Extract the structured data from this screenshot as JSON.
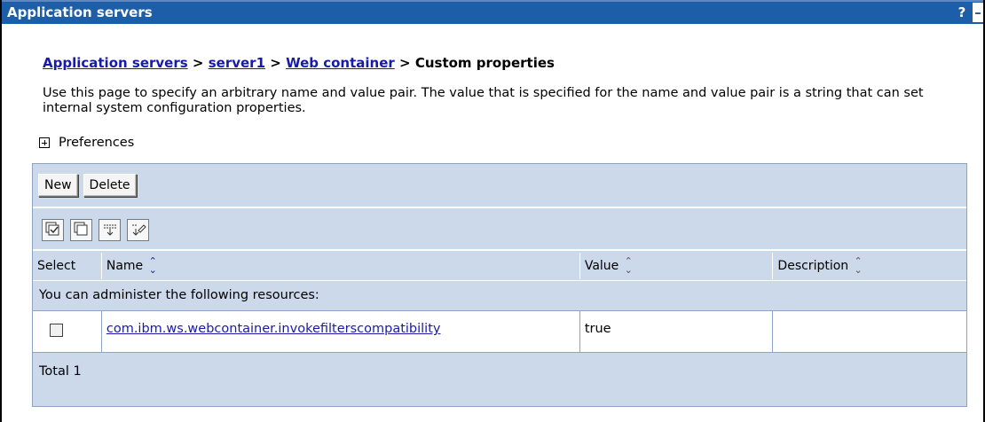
{
  "window": {
    "title": "Application servers",
    "help": "?",
    "minimize": "–"
  },
  "breadcrumb": {
    "items": [
      "Application servers",
      "server1",
      "Web container"
    ],
    "separator": ">",
    "current": "Custom properties"
  },
  "description": "Use this page to specify an arbitrary name and value pair. The value that is specified for the name and value pair is a string that can set internal system configuration properties.",
  "preferences": {
    "label": "Preferences"
  },
  "toolbar": {
    "new_label": "New",
    "delete_label": "Delete"
  },
  "icons": [
    "select-all-icon",
    "deselect-all-icon",
    "show-filter-icon",
    "clear-filter-icon"
  ],
  "table": {
    "headers": [
      "Select",
      "Name",
      "Value",
      "Description"
    ],
    "info": "You can administer the following resources:",
    "rows": [
      {
        "name": "com.ibm.ws.webcontainer.invokefilterscompatibility",
        "value": "true",
        "description": ""
      }
    ],
    "total": "Total 1"
  },
  "colors": {
    "titlebar": "#1c5ea8",
    "link": "#1a1aa8",
    "table_bg": "#ccd9ea"
  }
}
